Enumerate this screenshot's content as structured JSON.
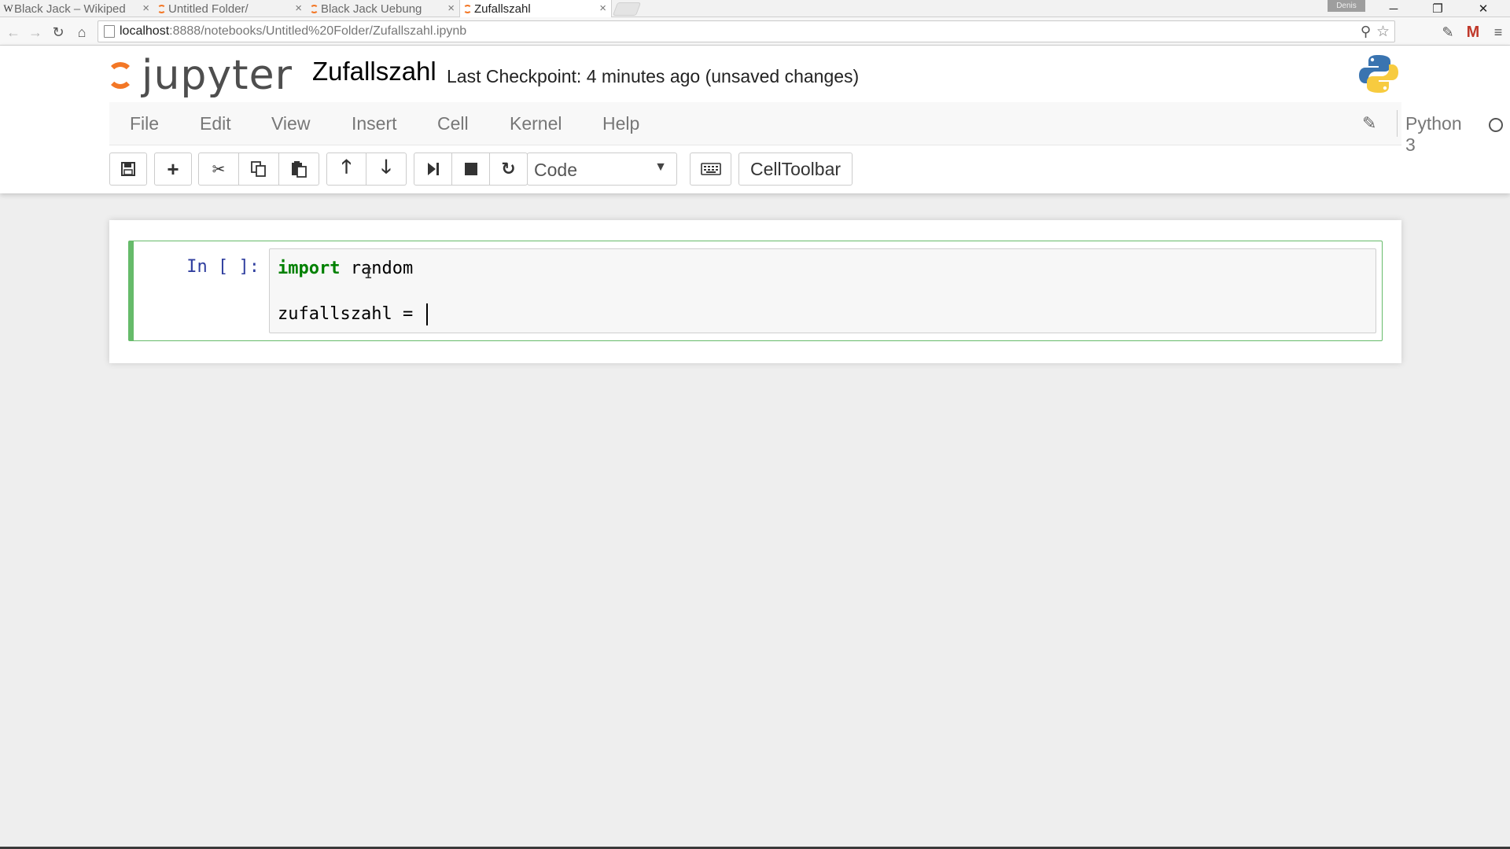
{
  "browser": {
    "tabs": [
      {
        "title": "Black Jack – Wikiped",
        "favicon": "wikipedia-icon"
      },
      {
        "title": "Untitled Folder/",
        "favicon": "jupyter-icon"
      },
      {
        "title": "Black Jack Uebung",
        "favicon": "jupyter-icon"
      },
      {
        "title": "Zufallszahl",
        "favicon": "jupyter-icon"
      }
    ],
    "user_badge": "Denis",
    "url_host": "localhost",
    "url_path": ":8888/notebooks/Untitled%20Folder/Zufallszahl.ipynb"
  },
  "header": {
    "logo_text": "jupyter",
    "notebook_name": "Zufallszahl",
    "checkpoint": "Last Checkpoint: 4 minutes ago (unsaved changes)"
  },
  "menu": {
    "items": [
      "File",
      "Edit",
      "View",
      "Insert",
      "Cell",
      "Kernel",
      "Help"
    ],
    "kernel_name": "Python 3"
  },
  "toolbar": {
    "cell_type": "Code",
    "celltoolbar_label": "CellToolbar"
  },
  "cell": {
    "prompt": "In [ ]:",
    "code_keyword": "import",
    "code_line1_rest": " random",
    "code_line3": "zufallszahl = "
  },
  "colors": {
    "accent_orange": "#f37726",
    "cell_edit_green": "#66bb6a",
    "prompt_blue": "#303f9f",
    "keyword_green": "#008000"
  }
}
